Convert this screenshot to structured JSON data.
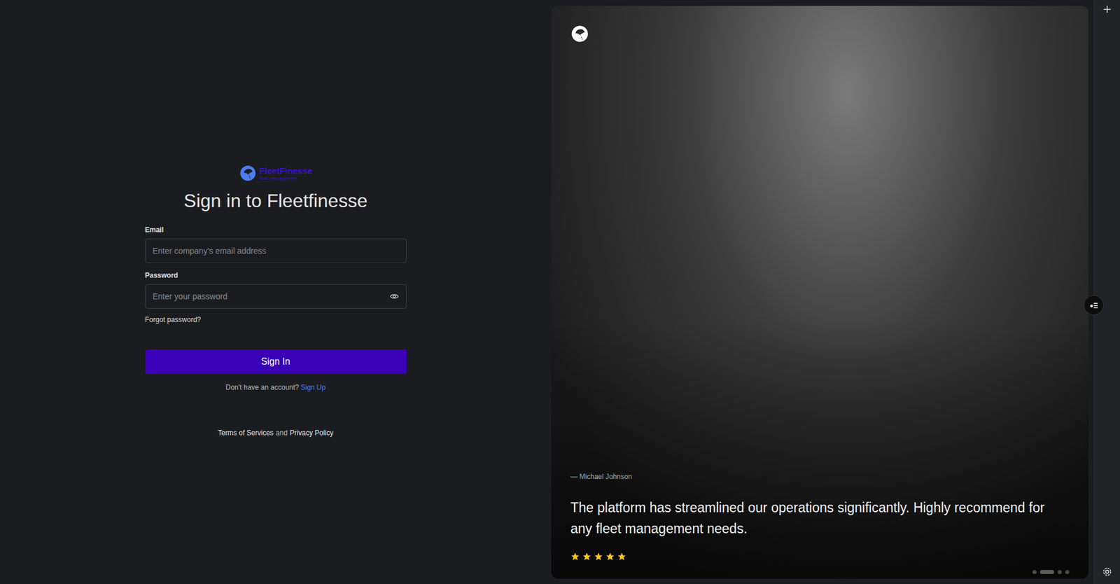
{
  "brand": {
    "name": "FleetFinesse",
    "tagline": "fleet management"
  },
  "title": "Sign in to Fleetfinesse",
  "fields": [
    {
      "label": "Email",
      "placeholder": "Enter company's email address",
      "kind": "text"
    },
    {
      "label": "Password",
      "placeholder": "Enter your password",
      "kind": "password"
    }
  ],
  "forgot": "Forgot password?",
  "submit": "Sign In",
  "signup": {
    "prompt": "Don't have an account?",
    "link": "Sign Up"
  },
  "legal": {
    "terms": "Terms of Services",
    "joiner": "and",
    "privacy": "Privacy Policy"
  },
  "testimonial": {
    "author": "— Michael Johnson",
    "quote": "The platform has streamlined our operations significantly. Highly recommend for any fleet management needs.",
    "stars": 5
  },
  "carousel": [
    {
      "selected": false
    },
    {
      "selected": true
    },
    {
      "selected": false
    },
    {
      "selected": false
    }
  ]
}
